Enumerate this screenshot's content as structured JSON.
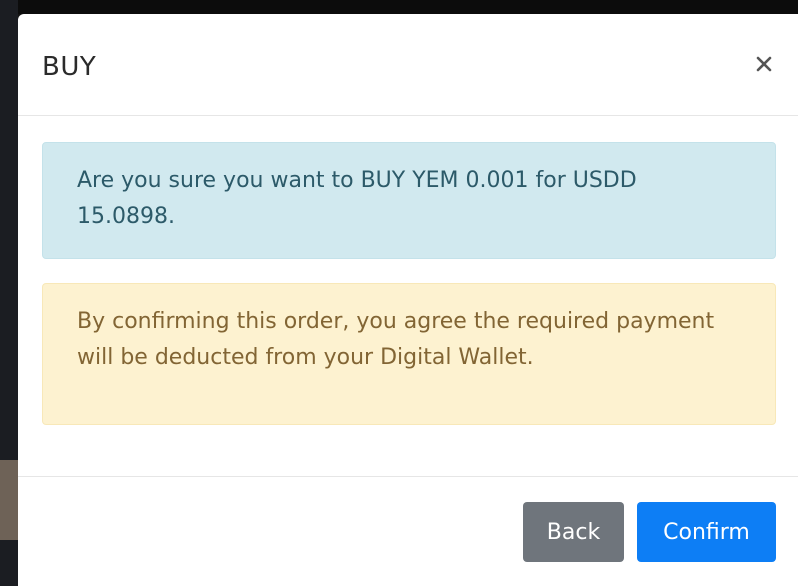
{
  "modal": {
    "title": "BUY",
    "close_icon": "close-icon",
    "info_message": "Are you sure you want to BUY YEM 0.001 for USDD 15.0898.",
    "warning_message": "By confirming this order, you agree the required payment will be deducted from your Digital Wallet.",
    "back_label": "Back",
    "confirm_label": "Confirm"
  },
  "colors": {
    "info_bg": "#d1e9ef",
    "info_text": "#2c5a69",
    "warning_bg": "#fdf2d0",
    "warning_text": "#826534",
    "back_button": "#6f757c",
    "confirm_button": "#0d7ef5"
  }
}
